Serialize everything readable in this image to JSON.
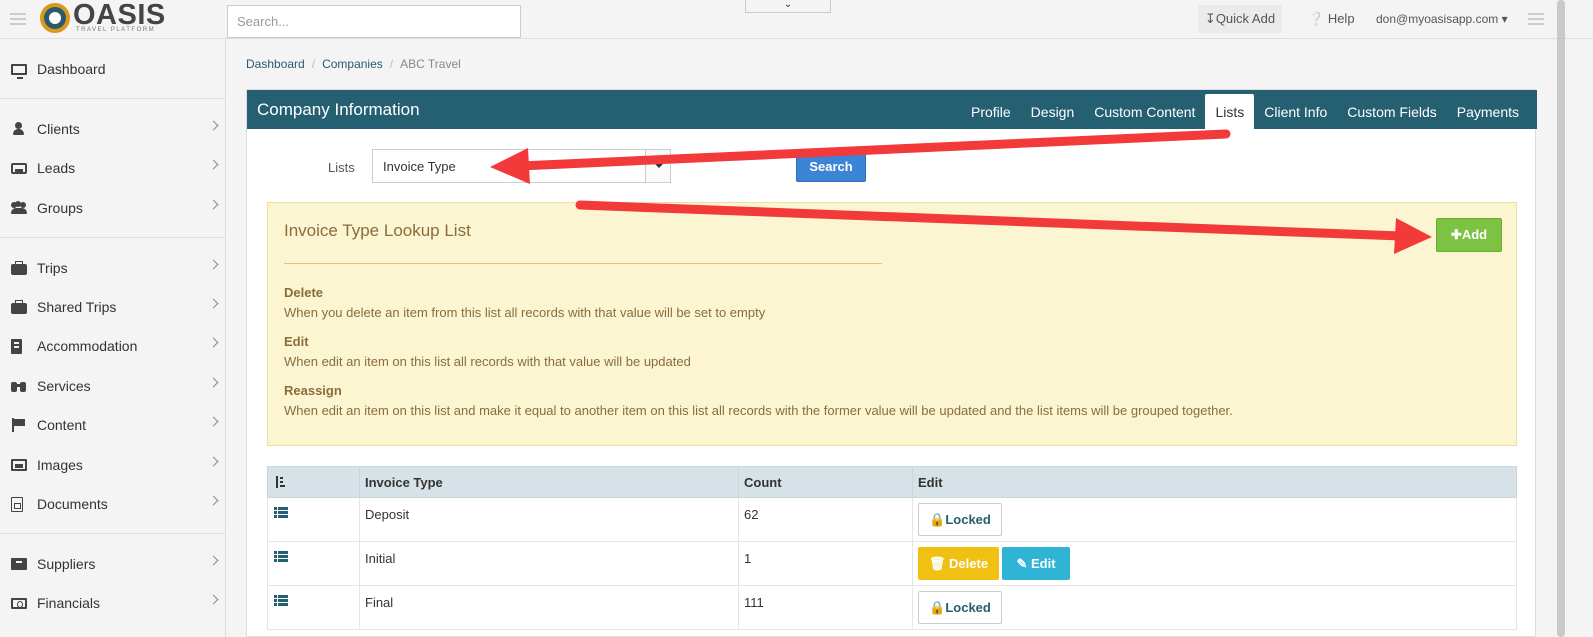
{
  "topbar": {
    "logo_text": "OASIS",
    "logo_sub": "TRAVEL PLATFORM",
    "search_placeholder": "Search...",
    "quick_add": "Quick Add",
    "help": "Help",
    "user_email": "don@myoasisapp.com"
  },
  "sidebar": {
    "items": [
      {
        "label": "Dashboard",
        "icon": "monitor-icon"
      },
      {
        "label": "Clients",
        "icon": "user-icon"
      },
      {
        "label": "Leads",
        "icon": "inbox-icon"
      },
      {
        "label": "Groups",
        "icon": "users-icon"
      },
      {
        "label": "Trips",
        "icon": "briefcase-icon"
      },
      {
        "label": "Shared Trips",
        "icon": "briefcase-icon"
      },
      {
        "label": "Accommodation",
        "icon": "building-icon"
      },
      {
        "label": "Services",
        "icon": "binoculars-icon"
      },
      {
        "label": "Content",
        "icon": "flag-icon"
      },
      {
        "label": "Images",
        "icon": "image-icon"
      },
      {
        "label": "Documents",
        "icon": "file-pdf-icon"
      },
      {
        "label": "Suppliers",
        "icon": "archive-icon"
      },
      {
        "label": "Financials",
        "icon": "money-icon"
      }
    ]
  },
  "breadcrumb": {
    "items": [
      "Dashboard",
      "Companies",
      "ABC Travel"
    ]
  },
  "panel": {
    "title": "Company Information",
    "tabs": [
      "Profile",
      "Design",
      "Custom Content",
      "Lists",
      "Client Info",
      "Custom Fields",
      "Payments"
    ],
    "active_tab": "Lists"
  },
  "filter": {
    "label": "Lists",
    "selected": "Invoice Type",
    "search_label": "Search"
  },
  "alert": {
    "title": "Invoice Type Lookup List",
    "add_label": "Add",
    "sections": [
      {
        "heading": "Delete",
        "text": "When you delete an item from this list all records with that value will be set to empty"
      },
      {
        "heading": "Edit",
        "text": "When edit an item on this list all records with that value will be updated"
      },
      {
        "heading": "Reassign",
        "text": "When edit an item on this list and make it equal to another item on this list all records with the former value will be updated and the list items will be grouped together."
      }
    ]
  },
  "table": {
    "headers": [
      "",
      "Invoice Type",
      "Count",
      "Edit"
    ],
    "rows": [
      {
        "type": "Deposit",
        "count": "62",
        "locked": true
      },
      {
        "type": "Initial",
        "count": "1",
        "locked": false
      },
      {
        "type": "Final",
        "count": "111",
        "locked": true
      }
    ],
    "locked_label": "Locked",
    "delete_label": "Delete",
    "edit_label": "Edit"
  },
  "colors": {
    "header": "#255f72",
    "add_button": "#7dc242",
    "search_button": "#3c85d6",
    "delete_button": "#f0c012",
    "edit_button": "#2fb4d6",
    "annotation_arrow": "#f23a3a",
    "alert_bg": "#fcf5d2"
  }
}
